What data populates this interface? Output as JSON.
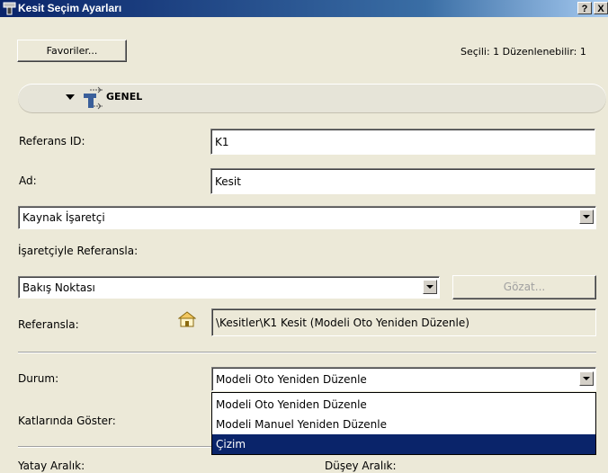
{
  "window": {
    "title": "Kesit Seçim Ayarları",
    "help_label": "?",
    "close_label": "X"
  },
  "toolbar": {
    "favorites_label": "Favoriler...",
    "selection_status": "Seçili: 1 Düzenlenebilir: 1"
  },
  "section": {
    "title": "GENEL"
  },
  "form": {
    "ref_id_label": "Referans ID:",
    "ref_id_value": "K1",
    "name_label": "Ad:",
    "name_value": "Kesit",
    "source_marker_value": "Kaynak İşaretçi",
    "ref_with_marker_label": "İşaretçiyle Referansla:",
    "viewpoint_value": "Bakış Noktası",
    "browse_label": "Gözat...",
    "reference_label": "Referansla:",
    "reference_value": "\\Kesitler\\K1 Kesit (Modeli Oto Yeniden Düzenle)",
    "status_label": "Durum:",
    "status_value": "Modeli Oto Yeniden Düzenle",
    "show_on_floors_label": "Katlarında Göster:",
    "horizontal_range_label": "Yatay Aralık:",
    "vertical_range_label": "Düşey Aralık:"
  },
  "status_dropdown": {
    "options": [
      "Modeli Oto Yeniden Düzenle",
      "Modeli Manuel Yeniden Düzenle",
      "Çizim"
    ],
    "highlighted": "Çizim"
  },
  "colors": {
    "selection": "#0a246a",
    "window_bg": "#ece9d8"
  }
}
